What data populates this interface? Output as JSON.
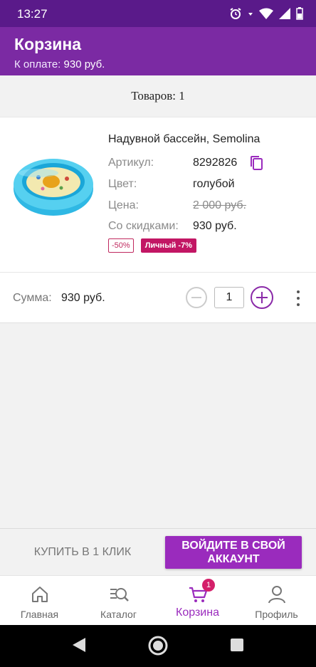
{
  "status": {
    "time": "13:27"
  },
  "header": {
    "title": "Корзина",
    "payment_label": "К оплате:",
    "payment_value": "930 руб."
  },
  "cart": {
    "items_count": "Товаров: 1"
  },
  "product": {
    "image_icon": "inflatable-pool-image",
    "name": "Надувной бассейн, Semolina",
    "article_label": "Артикул:",
    "article_value": "8292826",
    "color_label": "Цвет:",
    "color_value": "голубой",
    "price_label": "Цена:",
    "price_value": "2 000 руб.",
    "discount_label": "Со скидками:",
    "discount_value": "930 руб.",
    "badge_discount": "-50%",
    "badge_personal": "Личный -7%",
    "sum_label": "Сумма:",
    "sum_value": "930 руб.",
    "quantity": "1"
  },
  "actions": {
    "buy_one_click": "КУПИТЬ В 1 КЛИК",
    "login_line1": "ВОЙДИТЕ В СВОЙ",
    "login_line2": "АККАУНТ"
  },
  "nav": {
    "items": [
      {
        "label": "Главная",
        "icon": "home-icon"
      },
      {
        "label": "Каталог",
        "icon": "catalog-search-icon"
      },
      {
        "label": "Корзина",
        "icon": "cart-icon",
        "badge": "1"
      },
      {
        "label": "Профиль",
        "icon": "profile-icon"
      }
    ]
  },
  "colors": {
    "statusbar": "#5a1a8a",
    "appbar": "#7b2aa3",
    "accent": "#9a2bbd",
    "badge_red": "#c21664"
  }
}
